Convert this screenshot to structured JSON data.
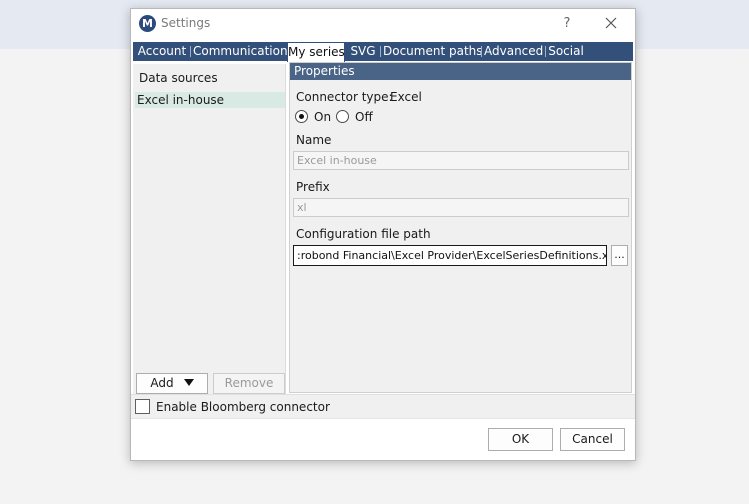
{
  "window": {
    "title": "Settings",
    "logo_letter": "M",
    "help_label": "?"
  },
  "tabs": [
    {
      "label": "Account",
      "active": false
    },
    {
      "label": "Communication",
      "active": false
    },
    {
      "label": "My series",
      "active": true
    },
    {
      "label": "SVG",
      "active": false
    },
    {
      "label": "Document paths",
      "active": false
    },
    {
      "label": "Advanced",
      "active": false
    },
    {
      "label": "Social",
      "active": false
    }
  ],
  "data_sources": {
    "header": "Data sources",
    "items": [
      {
        "label": "Excel in-house",
        "selected": true
      }
    ],
    "add_label": "Add",
    "remove_label": "Remove"
  },
  "properties": {
    "header": "Properties",
    "connector_type_label": "Connector type:",
    "connector_type_value": "Excel",
    "on_label": "On",
    "off_label": "Off",
    "on_selected": true,
    "name_label": "Name",
    "name_value": "Excel in-house",
    "prefix_label": "Prefix",
    "prefix_value": "xl",
    "config_path_label": "Configuration file path",
    "config_path_value": ":robond Financial\\Excel Provider\\ExcelSeriesDefinitions.xml",
    "browse_label": "..."
  },
  "bloomberg": {
    "label": "Enable Bloomberg connector",
    "checked": false
  },
  "footer": {
    "ok_label": "OK",
    "cancel_label": "Cancel"
  },
  "colors": {
    "tab_bar": "#33507a",
    "props_header": "#4a6487",
    "selected_item": "#d9eae5"
  }
}
